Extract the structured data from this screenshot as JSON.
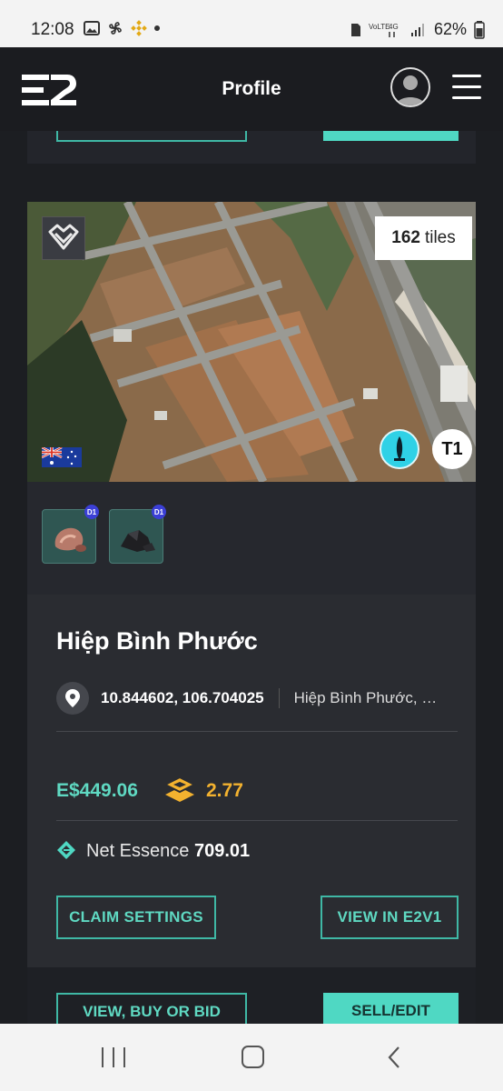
{
  "status_bar": {
    "time": "12:08",
    "battery": "62%",
    "network_label_1": "VoLTE",
    "network_label_2": "4G"
  },
  "header": {
    "title": "Profile"
  },
  "property": {
    "tiles_count": "162",
    "tiles_unit": "tiles",
    "tier_label": "T1",
    "resource_tags": [
      "D1",
      "D1"
    ],
    "name": "Hiệp Bình Phước",
    "coordinates": "10.844602, 106.704025",
    "location_name": "Hiệp Bình Phước, Qu...",
    "price": "E$449.06",
    "yield": "2.77",
    "essence_label": "Net Essence",
    "essence_value": "709.01",
    "claim_settings_label": "CLAIM SETTINGS",
    "view_e2v1_label": "VIEW IN E2V1"
  },
  "next_card": {
    "view_buy_bid_label": "VIEW, BUY OR BID",
    "sell_edit_label": "SELL/EDIT"
  },
  "colors": {
    "accent": "#4fd8c3",
    "price": "#5fd9c2",
    "yield": "#f3b22f",
    "background": "#1c1e22"
  }
}
